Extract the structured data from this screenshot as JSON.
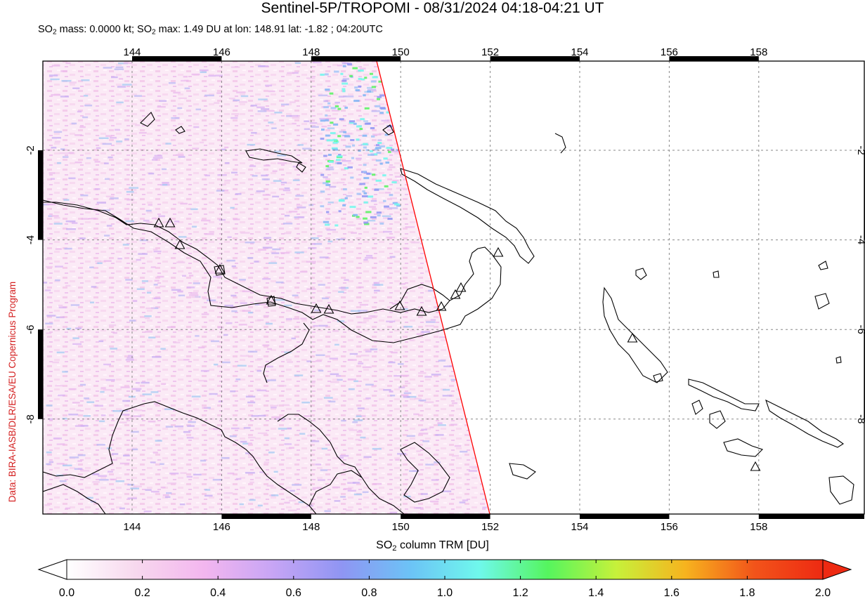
{
  "header": {
    "title": "Sentinel-5P/TROPOMI - 08/31/2024 04:18-04:21 UT",
    "subtitle_parts": [
      "SO",
      "2",
      " mass: 0.0000 kt; SO",
      "2",
      " max: 1.49 DU at lon: 148.91 lat: -1.82 ; 04:20UTC"
    ]
  },
  "credit": "Data: BIRA-IASB/DLR/ESA/EU Copernicus Program",
  "map": {
    "lon_ticks": [
      "144",
      "146",
      "148",
      "150",
      "152",
      "154",
      "156",
      "158"
    ],
    "lat_ticks": [
      "-2",
      "-4",
      "-6",
      "-8"
    ],
    "swath_edge_color": "#ff0000",
    "coastline_color": "#000000",
    "volcano_marker": "triangle"
  },
  "colorbar": {
    "label_parts": [
      "SO",
      "2",
      " column TRM [DU]"
    ],
    "ticks": [
      "0.0",
      "0.2",
      "0.4",
      "0.6",
      "0.8",
      "1.0",
      "1.2",
      "1.4",
      "1.6",
      "1.8",
      "2.0"
    ],
    "colors": [
      "#ffffff",
      "#f7d8ee",
      "#f3b6ef",
      "#c7a5f5",
      "#8f95f3",
      "#6cc3f6",
      "#6ff8ec",
      "#55f55e",
      "#c7f13a",
      "#f7b31e",
      "#f2541a",
      "#ee2a12"
    ]
  }
}
